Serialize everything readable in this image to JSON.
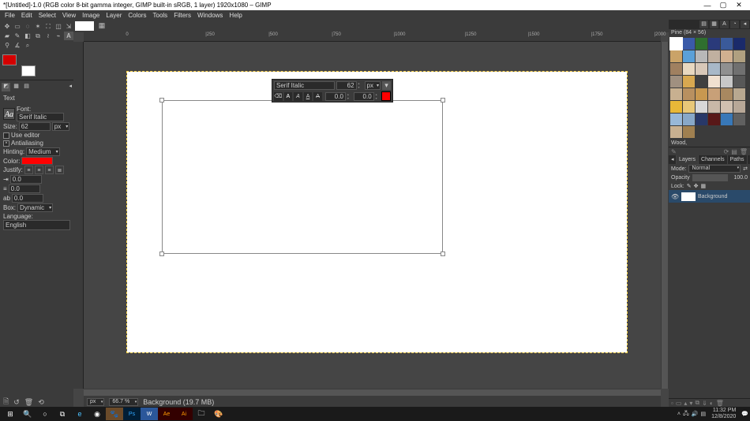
{
  "titlebar": {
    "title": "*[Untitled]-1.0 (RGB color 8-bit gamma integer, GIMP built-in sRGB, 1 layer) 1920x1080 – GIMP"
  },
  "menu": [
    "File",
    "Edit",
    "Select",
    "View",
    "Image",
    "Layer",
    "Colors",
    "Tools",
    "Filters",
    "Windows",
    "Help"
  ],
  "toolopts": {
    "header": "Text",
    "font_label": "Font:",
    "font_value": "Serif Italic",
    "font_preview": "Aa",
    "size_label": "Size:",
    "size_value": "62",
    "size_unit": "px",
    "use_editor": "Use editor",
    "antialias": "Antialiasing",
    "hinting_label": "Hinting:",
    "hinting_value": "Medium",
    "color_label": "Color:",
    "justify_label": "Justify:",
    "indent": "0.0",
    "linesp": "0.0",
    "lettersp": "0.0",
    "box_label": "Box:",
    "box_value": "Dynamic",
    "lang_label": "Language:",
    "lang_value": "English"
  },
  "overlay": {
    "font": "Serif Italic",
    "size": "62",
    "unit": "px",
    "baseline": "0.0",
    "kerning": "0.0"
  },
  "ruler_h": [
    {
      "pos": 55,
      "label": "0"
    },
    {
      "pos": 160,
      "label": "|250"
    },
    {
      "pos": 240,
      "label": "|500"
    },
    {
      "pos": 320,
      "label": "|750"
    },
    {
      "pos": 400,
      "label": "|1000"
    },
    {
      "pos": 490,
      "label": "|1250"
    },
    {
      "pos": 570,
      "label": "|1500"
    },
    {
      "pos": 650,
      "label": "|1750"
    },
    {
      "pos": 730,
      "label": "|2000"
    }
  ],
  "status": {
    "unit": "px",
    "zoom": "66.7 %",
    "layer": "Background (19.7 MB)"
  },
  "patterns": {
    "label_top": "Pine (84 × 56)",
    "label_bottom": "Wood,",
    "colors": [
      "#ffffff",
      "#3a5aa8",
      "#2f6f2f",
      "#2a3a7a",
      "#3a5a9a",
      "#1a2a6a",
      "#caa368",
      "#5aa0d8",
      "#b8b8b8",
      "#c0b0a0",
      "#d0b090",
      "#b0a080",
      "#a08060",
      "#e8d8c0",
      "#d8c8b8",
      "#a8b8c8",
      "#909090",
      "#707070",
      "#a09080",
      "#d8a850",
      "#404040",
      "#f0e0d0",
      "#c8c8c8",
      "#585858",
      "#c8b090",
      "#b89060",
      "#c89850",
      "#c8a078",
      "#a88860",
      "#b8a890",
      "#e8b838",
      "#e8c878",
      "#d8d8d8",
      "#c8b8a8",
      "#d0c0b0",
      "#b8a898",
      "#98b8d8",
      "#88a8c8",
      "#283868",
      "#581818",
      "#3878b8",
      "#606060",
      "#c8b090",
      "#a08050"
    ]
  },
  "layers": {
    "tabs": [
      "Layers",
      "Channels",
      "Paths"
    ],
    "mode_label": "Mode:",
    "mode_value": "Normal",
    "opacity_label": "Opacity",
    "opacity_value": "100.0",
    "lock_label": "Lock:",
    "bg_name": "Background"
  },
  "taskbar": {
    "time": "11:32 PM",
    "date": "12/8/2020"
  }
}
